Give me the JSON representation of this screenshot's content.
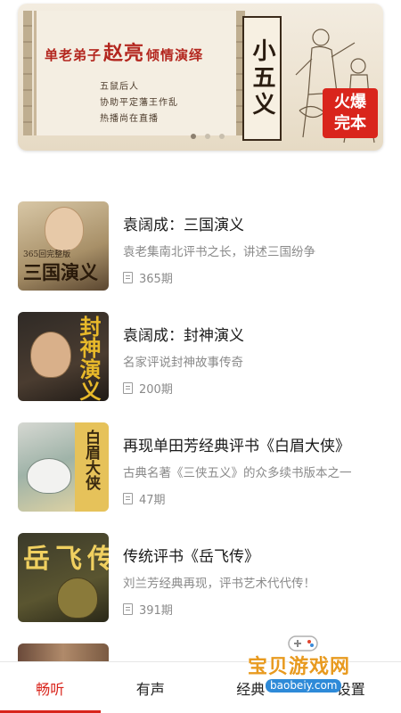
{
  "banner": {
    "title_pre": "单老弟子",
    "title_name": "赵亮",
    "title_post": "倾情演绎",
    "sub_line1": "五鼠后人",
    "sub_line2": "协助平定藩王作乱",
    "sub_line3": "热播尚在直播",
    "vertical_title": "小五义",
    "badge_line1": "火爆",
    "badge_line2": "完本",
    "dots": 3,
    "active_dot": 0
  },
  "list": [
    {
      "title": "袁阔成：三国演义",
      "desc": "袁老集南北评书之长，讲述三国纷争",
      "count": "365期",
      "cover_text": "三国演义",
      "cover_sub": "365回完整版"
    },
    {
      "title": "袁阔成：封神演义",
      "desc": "名家评说封神故事传奇",
      "count": "200期",
      "cover_text": "封神演义",
      "cover_sub": ""
    },
    {
      "title": "再现单田芳经典评书《白眉大侠》",
      "desc": "古典名著《三侠五义》的众多续书版本之一",
      "count": "47期",
      "cover_text": "白眉大侠",
      "cover_sub": ""
    },
    {
      "title": "传统评书《岳飞传》",
      "desc": "刘兰芳经典再现，评书艺术代代传！",
      "count": "391期",
      "cover_text": "岳飞传",
      "cover_sub": ""
    }
  ],
  "tabs": [
    {
      "label": "畅听",
      "active": true
    },
    {
      "label": "有声",
      "active": false
    },
    {
      "label": "经典",
      "active": false
    },
    {
      "label": "设置",
      "active": false
    }
  ],
  "watermark": {
    "text": "宝贝游戏网",
    "url": "baobeiy.com"
  },
  "colors": {
    "accent": "#d9251c",
    "muted": "#8a8a8a"
  }
}
